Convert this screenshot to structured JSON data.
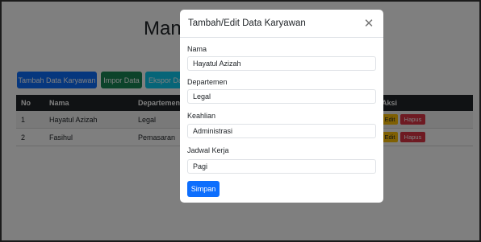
{
  "page": {
    "title": "Mana",
    "buttons": {
      "add": "Tambah Data Karyawan",
      "import": "Impor Data",
      "export": "Ekspor Da"
    },
    "table": {
      "headers": {
        "no": "No",
        "nama": "Nama",
        "departemen": "Departemen",
        "aksi": "Aksi"
      },
      "rows": [
        {
          "no": "1",
          "nama": "Hayatul Azizah",
          "departemen": "Legal",
          "edit": "Edit",
          "hapus": "Hapus"
        },
        {
          "no": "2",
          "nama": "Fasihul",
          "departemen": "Pemasaran",
          "edit": "Edit",
          "hapus": "Hapus"
        }
      ]
    }
  },
  "modal": {
    "title": "Tambah/Edit Data Karyawan",
    "close_icon": "close-icon",
    "fields": [
      {
        "label": "Nama",
        "value": "Hayatul Azizah"
      },
      {
        "label": "Departemen",
        "value": "Legal"
      },
      {
        "label": "Keahlian",
        "value": "Administrasi"
      },
      {
        "label": "Jadwal Kerja",
        "value": "Pagi"
      }
    ],
    "save_label": "Simpan"
  },
  "colors": {
    "primary": "#0d6efd",
    "success": "#198754",
    "info": "#0dcaf0",
    "warning": "#ffc107",
    "danger": "#dc3545",
    "table_header": "#212529"
  }
}
